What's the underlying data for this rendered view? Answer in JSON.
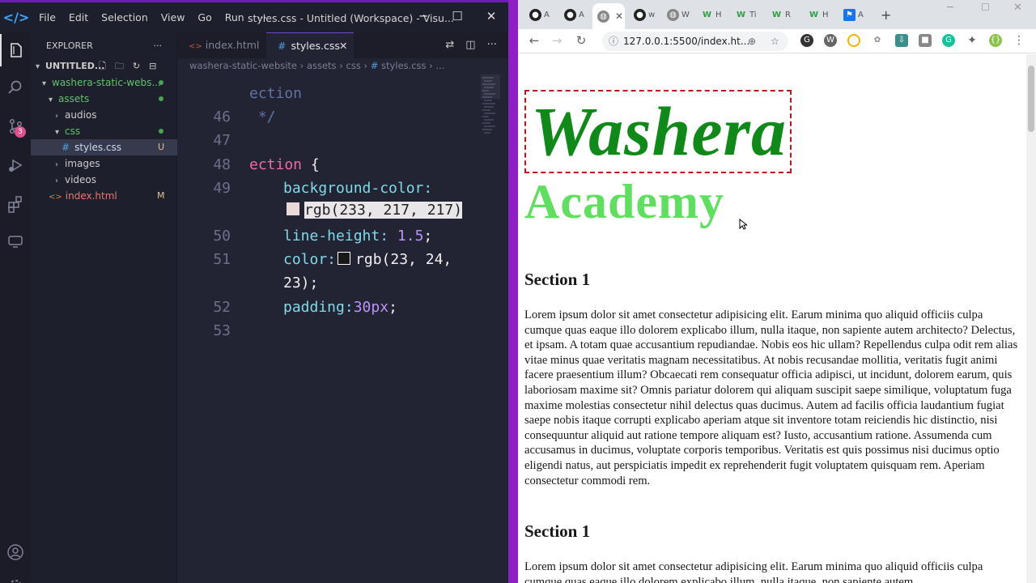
{
  "vscode": {
    "menu": [
      "File",
      "Edit",
      "Selection",
      "View",
      "Go",
      "Run",
      "···"
    ],
    "window_title": "styles.css - Untitled (Workspace) - Visu...",
    "explorer": {
      "title": "EXPLORER",
      "workspace": "UNTITLED...",
      "tree": [
        {
          "label": "washera-static-webs...",
          "indent": 0,
          "open": true,
          "folder": true
        },
        {
          "label": "assets",
          "indent": 1,
          "open": true,
          "folder": true
        },
        {
          "label": "audios",
          "indent": 2,
          "open": false,
          "folder": true
        },
        {
          "label": "css",
          "indent": 2,
          "open": true,
          "folder": true
        },
        {
          "label": "styles.css",
          "indent": 3,
          "badge": "U",
          "selected": true
        },
        {
          "label": "images",
          "indent": 2,
          "open": false,
          "folder": true
        },
        {
          "label": "videos",
          "indent": 2,
          "open": false,
          "folder": true
        },
        {
          "label": "index.html",
          "indent": 1,
          "badge": "M"
        }
      ]
    },
    "activity_badge": "3",
    "tabs": [
      {
        "label": "index.html",
        "active": false
      },
      {
        "label": "styles.css",
        "active": true
      }
    ],
    "breadcrumb": [
      "washera-static-website",
      "assets",
      "css",
      "styles.css",
      "..."
    ],
    "code": {
      "partial_comment": "ection",
      "comment_end": " */",
      "line_numbers": [
        "46",
        "47",
        "48",
        "49",
        "50",
        "51",
        "52",
        "53"
      ],
      "selector": "ection",
      "brace": " {",
      "prop1": "background-color:",
      "val1": "rgb(233, 217, 217)",
      "prop2": "line-height:",
      "val2": "1.5",
      "prop3": "color:",
      "val3a": "rgb(23, 24,",
      "val3b": "23);",
      "prop4": "padding:",
      "val4": "30px",
      "semi": ";"
    }
  },
  "browser": {
    "tabs": [
      {
        "icon": "github-icon",
        "letter": "A"
      },
      {
        "icon": "github-icon",
        "letter": "A"
      },
      {
        "icon": "globe-icon",
        "letter": "",
        "active": true
      },
      {
        "icon": "github-icon",
        "letter": "w"
      },
      {
        "icon": "globe-icon",
        "letter": "W"
      },
      {
        "icon": "w-icon",
        "letter": "H"
      },
      {
        "icon": "w-icon",
        "letter": "Ti"
      },
      {
        "icon": "w-icon",
        "letter": "R"
      },
      {
        "icon": "w-icon",
        "letter": "H"
      },
      {
        "icon": "flag-icon",
        "letter": "A"
      }
    ],
    "url": "127.0.0.1:5500/index.ht...",
    "page": {
      "logo": "Washera",
      "subtitle": "Academy",
      "sections": [
        {
          "heading": "Section 1",
          "text": "Lorem ipsum dolor sit amet consectetur adipisicing elit. Earum minima quo aliquid officiis culpa cumque quas eaque illo dolorem explicabo illum, nulla itaque, non sapiente autem architecto? Delectus, et ipsam. A totam quae accusantium repudiandae. Nobis eos hic ullam? Repellendus culpa odit rem alias vitae minus quae veritatis magnam necessitatibus. At nobis recusandae mollitia, veritatis fugit animi facere praesentium illum? Obcaecati rem consequatur officia adipisci, ut incidunt, dolorem earum, quis laboriosam maxime sit? Omnis pariatur dolorem qui aliquam suscipit saepe similique, voluptatum fuga maxime molestias consectetur nihil delectus quas ducimus. Autem ad facilis officia laudantium fugiat saepe nobis itaque corrupti explicabo aperiam atque sit inventore totam reiciendis hic distinctio, nisi consequuntur aliquid aut ratione tempore aliquam est? Iusto, accusantium ratione. Assumenda cum accusamus in ducimus, voluptate corporis temporibus. Veritatis est quis possimus nisi ducimus optio eligendi natus, aut perspiciatis impedit ex reprehenderit fugit voluptatem quisquam rem. Aperiam consectetur commodi rem."
        },
        {
          "heading": "Section 1",
          "text": "Lorem ipsum dolor sit amet consectetur adipisicing elit. Earum minima quo aliquid officiis culpa cumque quas eaque illo dolorem explicabo illum, nulla itaque, non sapiente autem"
        }
      ]
    }
  },
  "colors": {
    "accent_purple": "#8e1fc4",
    "logo_green": "#0f8a18",
    "academy_green": "#5ee05e",
    "logo_border": "#c0141b"
  }
}
